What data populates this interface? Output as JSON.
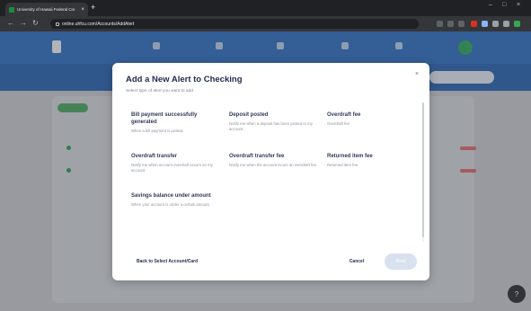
{
  "browser": {
    "tab_title": "University of Hawaii Federal Cre",
    "tab_close": "×",
    "new_tab": "+",
    "url": "online.uhfcu.com/Accounts/AddAlert"
  },
  "modal": {
    "title": "Add a New Alert to Checking",
    "subtitle": "Select type of alert you want to add",
    "close": "×",
    "options": [
      {
        "title": "Bill payment successfully generated",
        "desc": "When a bill payment is posted."
      },
      {
        "title": "Deposit posted",
        "desc": "Notify me when a deposit has been posted to my account."
      },
      {
        "title": "Overdraft fee",
        "desc": "Overdraft fee"
      },
      {
        "title": "Overdraft transfer",
        "desc": "Notify me when account overdraft occurs on my account."
      },
      {
        "title": "Overdraft transfer fee",
        "desc": "Notify me when the account incurs an overdraft fee."
      },
      {
        "title": "Returned item fee",
        "desc": "Returned item fee"
      },
      {
        "title": "Savings balance under amount",
        "desc": "When your account is under a certain amount."
      }
    ],
    "back_label": "Back to Select Account/Card",
    "cancel_label": "Cancel",
    "next_label": "Next"
  },
  "colors": {
    "header_blue": "#2f6fc1",
    "title_navy": "#1d2b4f",
    "disabled_button": "#d7e1ef"
  }
}
